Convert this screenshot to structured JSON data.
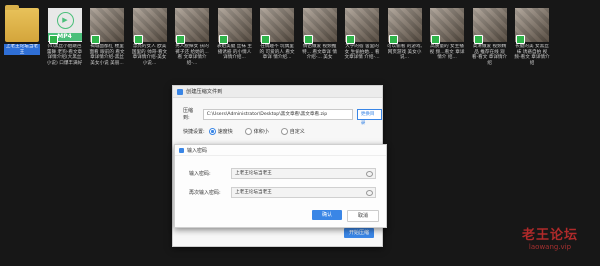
{
  "files": [
    {
      "name": "上老王论坛当老王",
      "type": "folder",
      "selected": true
    },
    {
      "name": "(4)黑丝小姐跳芭蕾舞 老狗-看文章 详情介绍(大黑丝小说) 口爆丰满好",
      "type": "mp4"
    },
    {
      "name": "褐城面都红 楼里面看 眼前的 看文章详情介绍-黑丝美女小说 美丽...",
      "type": "image"
    },
    {
      "name": "漂亮的女人 欧美国里的 帅哥-看文章详情介绍-美女小说...",
      "type": "image"
    },
    {
      "name": "男人脱掉女 孩的裤子还 给她的...看 文章详情介 绍-...",
      "type": "image"
    },
    {
      "name": "表姐美腿 丝袜 主播诱惑 的小情人 详情介绍...",
      "type": "image"
    },
    {
      "name": "在情趣不 玩偶里的 可爱的人 看文章详 情介绍...",
      "type": "image"
    },
    {
      "name": "情侣做爱 视频推特... 看文章详 情介绍-... 美女",
      "type": "image"
    },
    {
      "name": "大学的宿 舍里的女 生偷拍她... 看文章详情 介绍-...",
      "type": "image"
    },
    {
      "name": "可以偷看 的游戏, 网页游戏 美女小说...",
      "type": "image"
    },
    {
      "name": "高质量的 女主播视 频...看文 章详情介 绍...",
      "type": "image"
    },
    {
      "name": "高清做爱 视频精品 推荐在线 观看-看文 章详情介绍",
      "type": "image"
    },
    {
      "name": "长腿的美 女黑丝袜 诱惑自拍 视频-看文 章详情介绍",
      "type": "image"
    }
  ],
  "mp4_label": "MP4",
  "main_dialog": {
    "title": "创建压缩文件到",
    "path_label": "压缩到:",
    "path_value": "C:\\Users\\Administrator\\Desktop\\黑文章看\\黑文章看.zip",
    "change_dir": "更换目录",
    "settings_label": "快捷设置:",
    "options": [
      "速度快",
      "体积小",
      "自定义"
    ],
    "selected_option": 0,
    "start_button": "开始压缩"
  },
  "password_dialog": {
    "title": "输入密码",
    "field1_label": "输入密码:",
    "field1_value": "上老王论坛当老王",
    "field2_label": "再次输入密码:",
    "field2_value": "上老王论坛当老王",
    "ok": "确认",
    "cancel": "取消"
  },
  "watermark": {
    "line1": "老王论坛",
    "line2": "laowang.vip"
  },
  "colors": {
    "accent": "#3a86e6",
    "background": "#171717",
    "watermark": "#b02a2a"
  }
}
